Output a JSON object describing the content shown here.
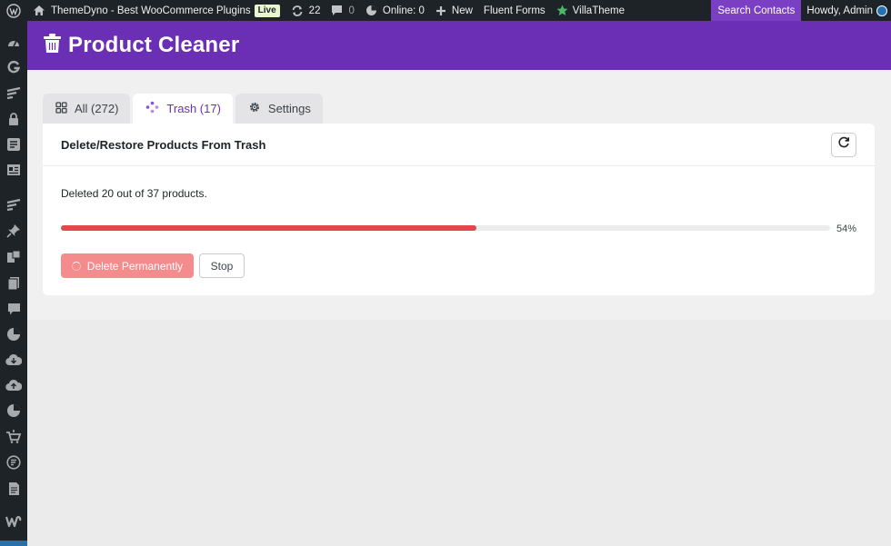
{
  "adminbar": {
    "site_name": "ThemeDyno - Best WooCommerce Plugins",
    "live_badge": "Live",
    "updates_count": "22",
    "comments_count": "0",
    "online": "Online: 0",
    "new": "New",
    "fluent_forms": "Fluent Forms",
    "villatheme": "VillaTheme",
    "search_contacts": "Search Contacts",
    "howdy": "Howdy, Admin"
  },
  "header": {
    "title": "Product Cleaner"
  },
  "tabs": [
    {
      "label": "All (272)",
      "icon": "grid-icon"
    },
    {
      "label": "Trash (17)",
      "icon": "sparkle-icon",
      "active": true
    },
    {
      "label": "Settings",
      "icon": "gear-icon"
    }
  ],
  "panel": {
    "title": "Delete/Restore Products From Trash",
    "status": "Deleted 20 out of 37 products.",
    "progress_percent": 54,
    "progress_label": "54%",
    "delete_label": "Delete Permanently",
    "stop_label": "Stop"
  },
  "colors": {
    "brand": "#6b2fb5",
    "progress": "#e2474d",
    "delete_button": "#f48b8d",
    "adminbar": "#1d2327",
    "search_highlight": "#7b3fc4"
  }
}
